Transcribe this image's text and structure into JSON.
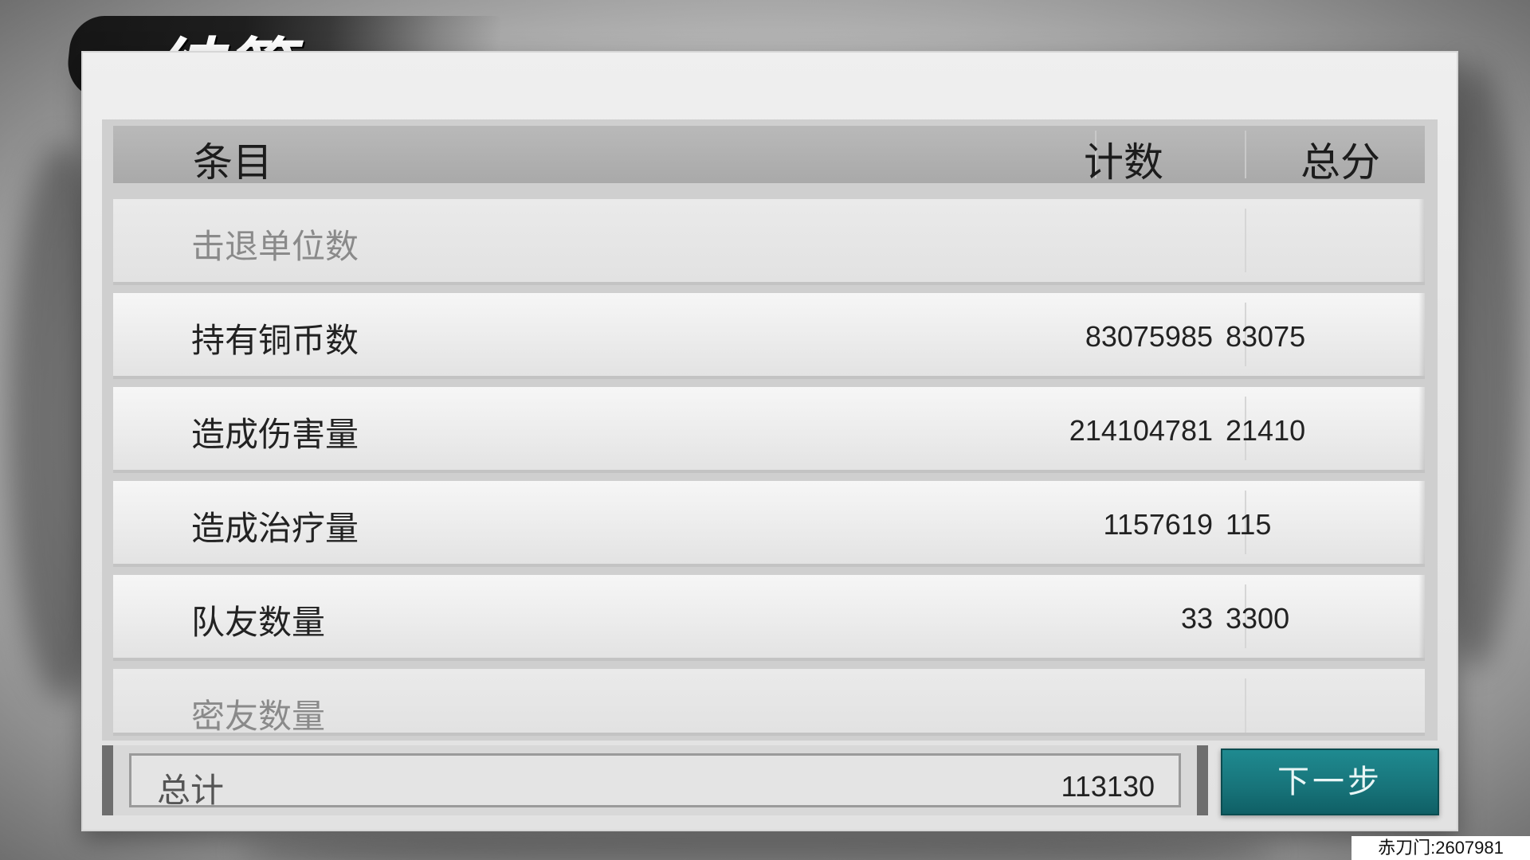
{
  "title": "结算",
  "table": {
    "headers": {
      "item": "条目",
      "count": "计数",
      "score": "总分"
    },
    "rows": [
      {
        "item": "击退单位数",
        "count": "",
        "score": ""
      },
      {
        "item": "持有铜币数",
        "count": "83075985",
        "score": "83075"
      },
      {
        "item": "造成伤害量",
        "count": "214104781",
        "score": "21410"
      },
      {
        "item": "造成治疗量",
        "count": "1157619",
        "score": "115"
      },
      {
        "item": "队友数量",
        "count": "33",
        "score": "3300"
      },
      {
        "item": "密友数量",
        "count": "",
        "score": ""
      }
    ]
  },
  "total": {
    "label": "总计",
    "value": "113130"
  },
  "next_button": "下一步",
  "room_id": "赤刀门:2607981",
  "colors": {
    "button_teal": "#177379",
    "title_ink": "#161616",
    "header_gray": "#a9a9a9"
  }
}
